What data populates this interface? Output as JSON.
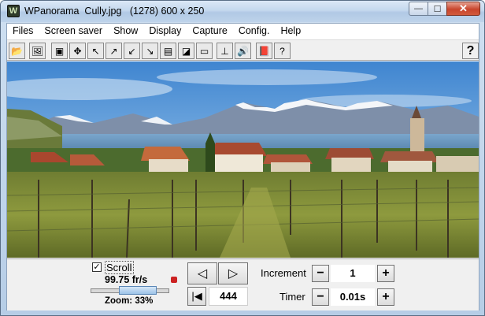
{
  "window": {
    "title": "WPanorama  Cully.jpg   (1278) 600 x 250",
    "app_icon_letter": "W",
    "minimize_glyph": "—",
    "maximize_glyph": "☐",
    "close_glyph": "✕"
  },
  "menu": {
    "items": [
      "Files",
      "Screen saver",
      "Show",
      "Display",
      "Capture",
      "Config.",
      "Help"
    ]
  },
  "toolbar": {
    "buttons": [
      {
        "name": "open-icon",
        "glyph": "📂"
      },
      {
        "name": "picture-icon",
        "glyph": "🖼"
      },
      {
        "name": "frame-icon",
        "glyph": "▣"
      },
      {
        "name": "move-icon",
        "glyph": "✥"
      },
      {
        "name": "arrow-up-left-icon",
        "glyph": "↖"
      },
      {
        "name": "arrow-out-icon",
        "glyph": "↗"
      },
      {
        "name": "arrow-in-icon",
        "glyph": "↙"
      },
      {
        "name": "arrow-down-right-icon",
        "glyph": "↘"
      },
      {
        "name": "fit-screen-icon",
        "glyph": "▤"
      },
      {
        "name": "stretch-icon",
        "glyph": "◪"
      },
      {
        "name": "width-icon",
        "glyph": "▭"
      },
      {
        "name": "height-icon",
        "glyph": "⊥"
      },
      {
        "name": "sound-icon",
        "glyph": "🔊"
      },
      {
        "name": "book-icon",
        "glyph": "📕"
      },
      {
        "name": "help-book-icon",
        "glyph": "?"
      }
    ],
    "help_glyph": "?"
  },
  "controls": {
    "scroll_checked_glyph": "✓",
    "scroll_label": "Scroll",
    "fps": "99.75 fr/s",
    "zoom_label": "Zoom: 33%",
    "zoom_level": 0.33,
    "prev_glyph": "◁",
    "next_glyph": "▷",
    "start_glyph": "|◀",
    "frame_value": "444",
    "increment_label": "Increment",
    "increment_value": "1",
    "timer_label": "Timer",
    "timer_value": "0.01s",
    "minus_glyph": "−",
    "plus_glyph": "+"
  },
  "colors": {
    "sky": "#5d9ad6",
    "lake": "#5e8fb8",
    "vineyard": "#7d8a3a"
  }
}
